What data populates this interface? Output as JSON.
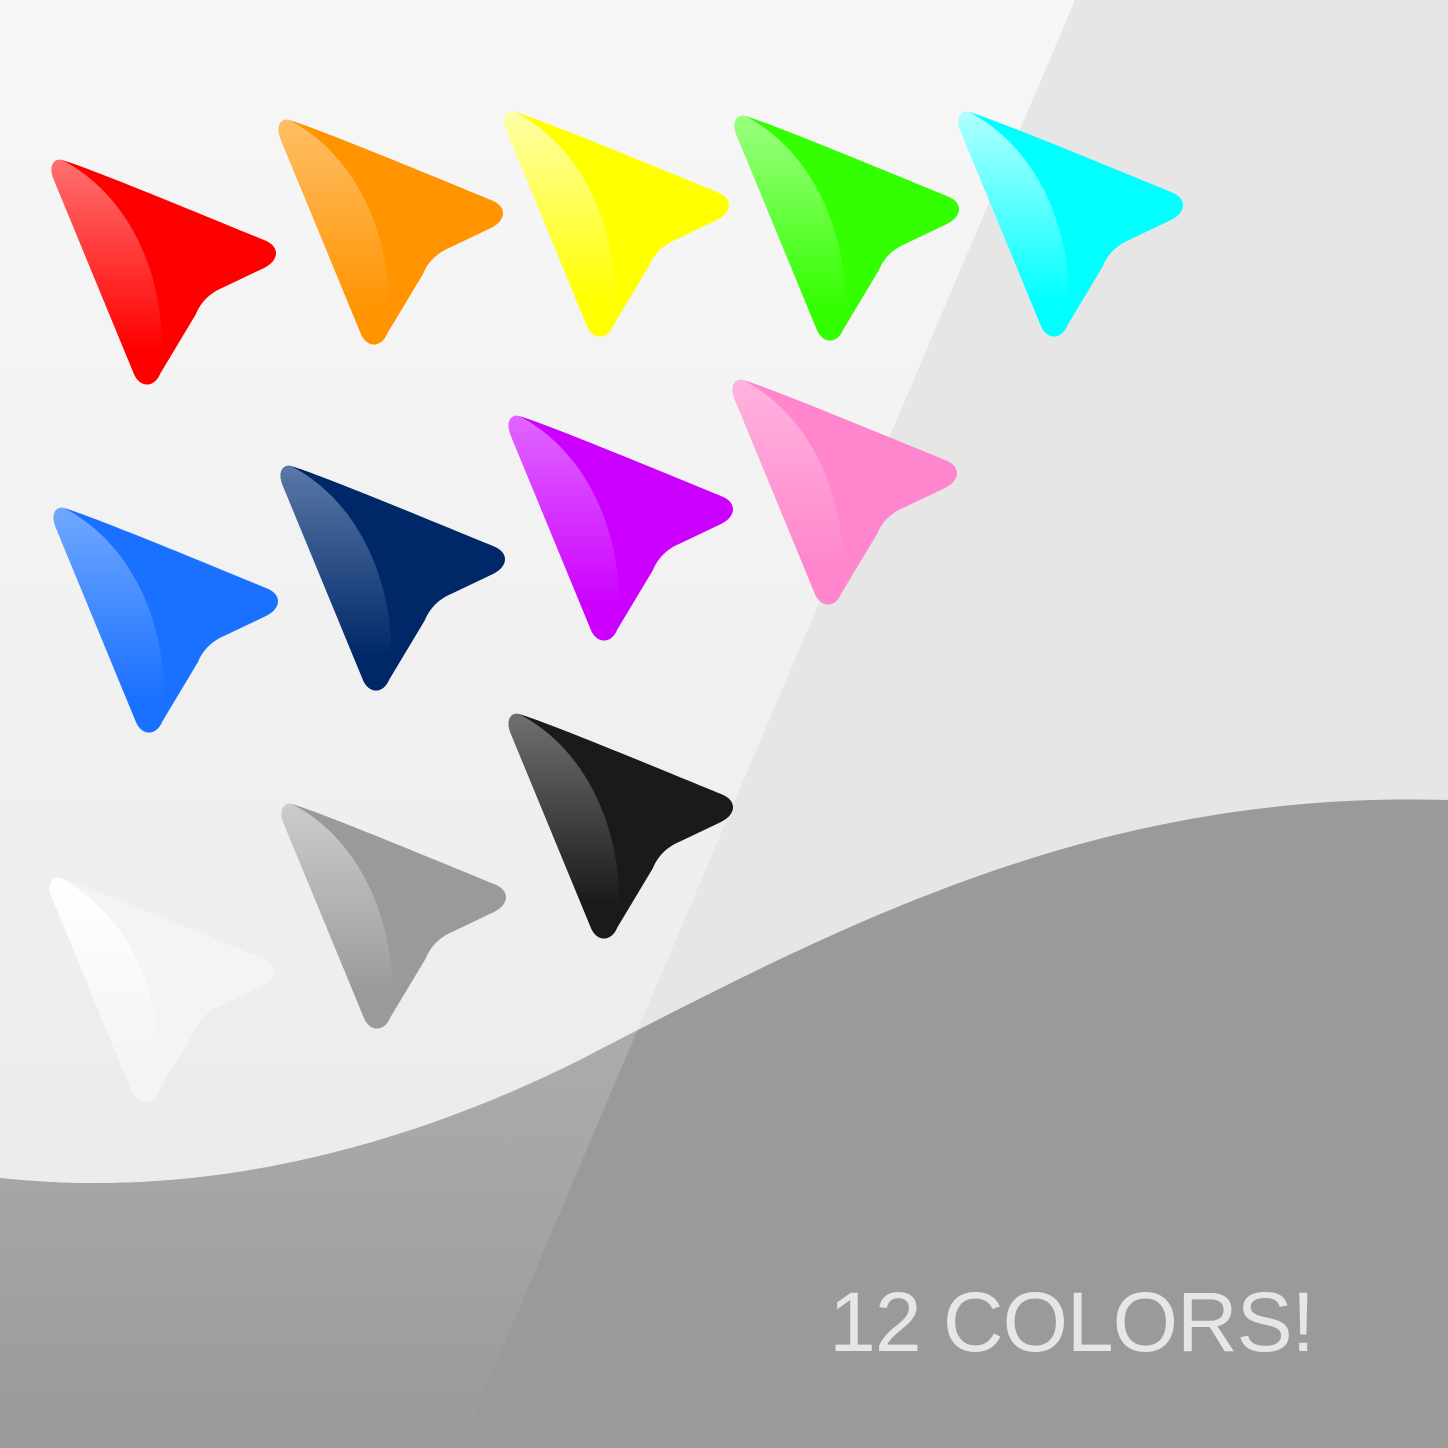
{
  "caption": "12 COLORS!",
  "background": {
    "light": "#f5f5f5",
    "mid": "#e6e6e6",
    "wave": "#9a9a9a"
  },
  "cursors": [
    {
      "name": "red-cursor-icon",
      "color": "#ff0000",
      "highlight": "#ff7070"
    },
    {
      "name": "orange-cursor-icon",
      "color": "#ff9400",
      "highlight": "#ffbe66"
    },
    {
      "name": "yellow-cursor-icon",
      "color": "#ffff00",
      "highlight": "#ffffa6"
    },
    {
      "name": "green-cursor-icon",
      "color": "#33ff00",
      "highlight": "#9cff80"
    },
    {
      "name": "cyan-cursor-icon",
      "color": "#00ffff",
      "highlight": "#b0ffff"
    },
    {
      "name": "blue-cursor-icon",
      "color": "#1a70ff",
      "highlight": "#70a8ff"
    },
    {
      "name": "navy-cursor-icon",
      "color": "#002868",
      "highlight": "#5a78a8"
    },
    {
      "name": "purple-cursor-icon",
      "color": "#cc00ff",
      "highlight": "#e066ff"
    },
    {
      "name": "pink-cursor-icon",
      "color": "#ff85cc",
      "highlight": "#ffb3de"
    },
    {
      "name": "white-cursor-icon",
      "color": "#f4f4f4",
      "highlight": "#ffffff"
    },
    {
      "name": "gray-cursor-icon",
      "color": "#9a9a9a",
      "highlight": "#cccccc"
    },
    {
      "name": "black-cursor-icon",
      "color": "#1a1a1a",
      "highlight": "#707070"
    }
  ]
}
